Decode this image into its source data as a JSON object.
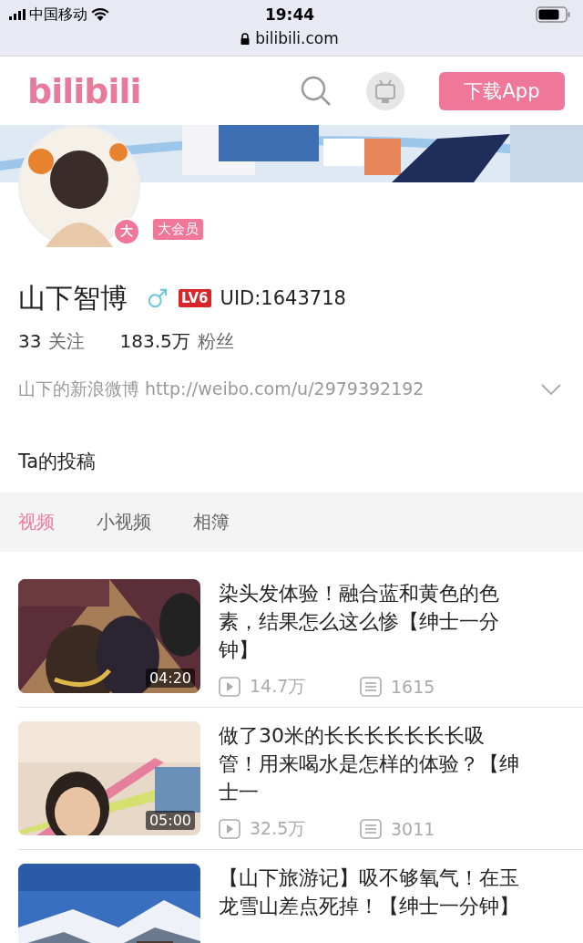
{
  "status_bar": {
    "carrier": "中国移动",
    "time": "19:44",
    "url": "bilibili.com"
  },
  "nav": {
    "logo": "bilibili",
    "download_button": "下载App"
  },
  "profile": {
    "avatar_badge": "大",
    "vip_badge": "大会员",
    "name": "山下智博",
    "level": "LV6",
    "uid": "UID:1643718",
    "following_count": "33",
    "following_label": "关注",
    "followers_count": "183.5万",
    "followers_label": "粉丝",
    "bio": "山下的新浪微博 http://weibo.com/u/2979392192",
    "bio_expanded": false
  },
  "section_title": "Ta的投稿",
  "tabs": [
    {
      "label": "视频",
      "selected": true
    },
    {
      "label": "小视频",
      "selected": false
    },
    {
      "label": "相簿",
      "selected": false
    }
  ],
  "videos": [
    {
      "title": "染头发体验！融合蓝和黄色的色素，结果怎么这么惨【绅士一分钟】",
      "duration": "04:20",
      "views": "14.7万",
      "comments": "1615"
    },
    {
      "title": "做了30米的长长长长长长长吸管！用来喝水是怎样的体验？【绅士一",
      "duration": "05:00",
      "views": "32.5万",
      "comments": "3011"
    },
    {
      "title": "【山下旅游记】吸不够氧气！在玉龙雪山差点死掉！【绅士一分钟】"
    }
  ]
}
